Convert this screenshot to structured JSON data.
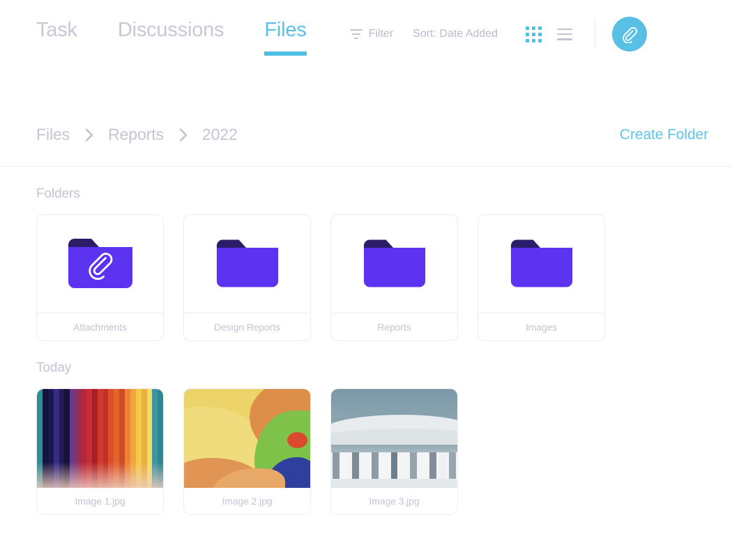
{
  "header": {
    "tabs": [
      {
        "label": "Task",
        "active": false
      },
      {
        "label": "Discussions",
        "active": false
      },
      {
        "label": "Files",
        "active": true
      }
    ],
    "toolbar": {
      "filter_label": "Filter",
      "sort_label": "Sort: Date Added",
      "grid_view_icon": "grid-view-icon",
      "list_view_icon": "list-view-icon",
      "attach_icon": "paperclip-icon"
    }
  },
  "breadcrumb": {
    "items": [
      "Files",
      "Reports",
      "2022"
    ],
    "separator": "chevron-right-icon",
    "create_folder_label": "Create Folder"
  },
  "sections": [
    {
      "label": "Folders",
      "items": [
        {
          "name": "Attachments",
          "icon": "folder-paperclip-icon"
        },
        {
          "name": "Design Reports",
          "icon": "folder-icon"
        },
        {
          "name": "Reports",
          "icon": "folder-icon"
        },
        {
          "name": "Images",
          "icon": "folder-icon"
        }
      ]
    },
    {
      "label": "Today",
      "items": [
        {
          "name": "Image 1.jpg",
          "thumb": "rainbow-slats-photo"
        },
        {
          "name": "Image 2.jpg",
          "thumb": "abstract-curves-photo"
        },
        {
          "name": "Image 3.jpg",
          "thumb": "white-architecture-photo"
        }
      ]
    }
  ],
  "colors": {
    "accent_cyan": "#4fc0e3",
    "folder_purple": "#5b33f0",
    "folder_tab_navy": "#2c1d6b",
    "muted_text": "#c3c4d4",
    "divider": "#eff0f6"
  }
}
